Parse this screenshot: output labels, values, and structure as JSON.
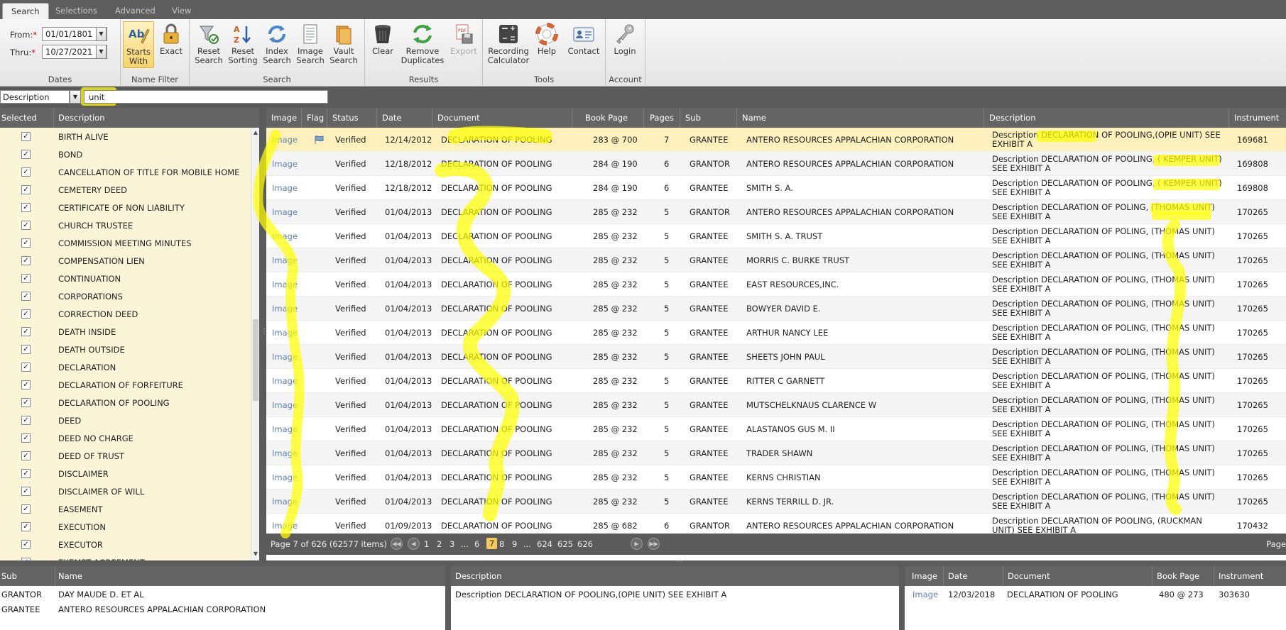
{
  "tabs": [
    {
      "label": "Search",
      "active": true
    },
    {
      "label": "Selections",
      "active": false
    },
    {
      "label": "Advanced",
      "active": false
    },
    {
      "label": "View",
      "active": false
    }
  ],
  "ribbon": {
    "dates": {
      "from_label": "From:",
      "from_value": "01/01/1801",
      "thru_label": "Thru:",
      "thru_value": "10/27/2021",
      "group_label": "Dates"
    },
    "name_filter": {
      "starts_with": "Starts With",
      "exact": "Exact",
      "group_label": "Name Filter"
    },
    "search": {
      "reset_search": "Reset Search",
      "reset_sorting": "Reset Sorting",
      "index_search": "Index Search",
      "image_search": "Image Search",
      "vault_search": "Vault Search",
      "group_label": "Search"
    },
    "results": {
      "clear": "Clear",
      "remove_duplicates": "Remove Duplicates",
      "export": "Export",
      "group_label": "Results"
    },
    "tools": {
      "recording_calculator": "Recording Calculator",
      "help": "Help",
      "contact": "Contact",
      "group_label": "Tools"
    },
    "account": {
      "login": "Login",
      "group_label": "Account"
    }
  },
  "filter": {
    "field": "Description",
    "value": "unit"
  },
  "left_panel": {
    "headers": {
      "selected": "Selected",
      "description": "Description"
    },
    "items": [
      "BIRTH ALIVE",
      "BOND",
      "CANCELLATION OF TITLE FOR MOBILE HOME",
      "CEMETERY DEED",
      "CERTIFICATE OF NON LIABILITY",
      "CHURCH TRUSTEE",
      "COMMISSION MEETING MINUTES",
      "COMPENSATION LIEN",
      "CONTINUATION",
      "CORPORATIONS",
      "CORRECTION DEED",
      "DEATH INSIDE",
      "DEATH OUTSIDE",
      "DECLARATION",
      "DECLARATION OF FORFEITURE",
      "DECLARATION OF POOLING",
      "DEED",
      "DEED NO CHARGE",
      "DEED OF TRUST",
      "DISCLAIMER",
      "DISCLAIMER OF WILL",
      "EASEMENT",
      "EXECUTION",
      "EXECUTOR",
      "EXEMPT AGREEMENT"
    ],
    "check_mark": "✓"
  },
  "grid": {
    "headers": {
      "image": "Image",
      "flag": "Flag",
      "status": "Status",
      "date": "Date",
      "document": "Document",
      "book_page": "Book Page",
      "pages": "Pages",
      "sub": "Sub",
      "name": "Name",
      "description": "Description",
      "instrument": "Instrument"
    },
    "rows": [
      {
        "image": "Image",
        "status": "Verified",
        "date": "12/14/2012",
        "document": "DECLARATION OF POOLING",
        "book_page": "283 @ 700",
        "pages": "7",
        "sub": "GRANTEE",
        "name": "ANTERO RESOURCES APPALACHIAN CORPORATION",
        "description": "Description DECLARATION OF POOLING,(OPIE UNIT) SEE EXHIBIT A",
        "instrument": "169681",
        "flag": true
      },
      {
        "image": "Image",
        "status": "Verified",
        "date": "12/18/2012",
        "document": "DECLARATION OF POOLING",
        "book_page": "284 @ 190",
        "pages": "6",
        "sub": "GRANTOR",
        "name": "ANTERO RESOURCES APPALACHIAN CORPORATION",
        "description": "Description DECLARATION OF POOLING, ( KEMPER UNIT) SEE EXHIBIT A",
        "instrument": "169808",
        "flag": false
      },
      {
        "image": "Image",
        "status": "Verified",
        "date": "12/18/2012",
        "document": "DECLARATION OF POOLING",
        "book_page": "284 @ 190",
        "pages": "6",
        "sub": "GRANTEE",
        "name": "SMITH S. A.",
        "description": "Description DECLARATION OF POOLING, ( KEMPER UNIT) SEE EXHIBIT A",
        "instrument": "169808",
        "flag": false
      },
      {
        "image": "Image",
        "status": "Verified",
        "date": "01/04/2013",
        "document": "DECLARATION OF POOLING",
        "book_page": "285 @ 232",
        "pages": "5",
        "sub": "GRANTOR",
        "name": "ANTERO RESOURCES APPALACHIAN CORPORATION",
        "description": "Description DECLARATION OF POLING, (THOMAS UNIT) SEE EXHIBIT A",
        "instrument": "170265",
        "flag": false
      },
      {
        "image": "Image",
        "status": "Verified",
        "date": "01/04/2013",
        "document": "DECLARATION OF POOLING",
        "book_page": "285 @ 232",
        "pages": "5",
        "sub": "GRANTEE",
        "name": "SMITH S. A. TRUST",
        "description": "Description DECLARATION OF POLING, (THOMAS UNIT) SEE EXHIBIT A",
        "instrument": "170265",
        "flag": false
      },
      {
        "image": "Image",
        "status": "Verified",
        "date": "01/04/2013",
        "document": "DECLARATION OF POOLING",
        "book_page": "285 @ 232",
        "pages": "5",
        "sub": "GRANTEE",
        "name": "MORRIS C. BURKE TRUST",
        "description": "Description DECLARATION OF POLING, (THOMAS UNIT) SEE EXHIBIT A",
        "instrument": "170265",
        "flag": false
      },
      {
        "image": "Image",
        "status": "Verified",
        "date": "01/04/2013",
        "document": "DECLARATION OF POOLING",
        "book_page": "285 @ 232",
        "pages": "5",
        "sub": "GRANTEE",
        "name": "EAST RESOURCES,INC.",
        "description": "Description DECLARATION OF POLING, (THOMAS UNIT) SEE EXHIBIT A",
        "instrument": "170265",
        "flag": false
      },
      {
        "image": "Image",
        "status": "Verified",
        "date": "01/04/2013",
        "document": "DECLARATION OF POOLING",
        "book_page": "285 @ 232",
        "pages": "5",
        "sub": "GRANTEE",
        "name": "BOWYER DAVID E.",
        "description": "Description DECLARATION OF POLING, (THOMAS UNIT) SEE EXHIBIT A",
        "instrument": "170265",
        "flag": false
      },
      {
        "image": "Image",
        "status": "Verified",
        "date": "01/04/2013",
        "document": "DECLARATION OF POOLING",
        "book_page": "285 @ 232",
        "pages": "5",
        "sub": "GRANTEE",
        "name": "ARTHUR NANCY LEE",
        "description": "Description DECLARATION OF POLING, (THOMAS UNIT) SEE EXHIBIT A",
        "instrument": "170265",
        "flag": false
      },
      {
        "image": "Image",
        "status": "Verified",
        "date": "01/04/2013",
        "document": "DECLARATION OF POOLING",
        "book_page": "285 @ 232",
        "pages": "5",
        "sub": "GRANTEE",
        "name": "SHEETS JOHN PAUL",
        "description": "Description DECLARATION OF POLING, (THOMAS UNIT) SEE EXHIBIT A",
        "instrument": "170265",
        "flag": false
      },
      {
        "image": "Image",
        "status": "Verified",
        "date": "01/04/2013",
        "document": "DECLARATION OF POOLING",
        "book_page": "285 @ 232",
        "pages": "5",
        "sub": "GRANTEE",
        "name": "RITTER C GARNETT",
        "description": "Description DECLARATION OF POLING, (THOMAS UNIT) SEE EXHIBIT A",
        "instrument": "170265",
        "flag": false
      },
      {
        "image": "Image",
        "status": "Verified",
        "date": "01/04/2013",
        "document": "DECLARATION OF POOLING",
        "book_page": "285 @ 232",
        "pages": "5",
        "sub": "GRANTEE",
        "name": "MUTSCHELKNAUS CLARENCE W",
        "description": "Description DECLARATION OF POLING, (THOMAS UNIT) SEE EXHIBIT A",
        "instrument": "170265",
        "flag": false
      },
      {
        "image": "Image",
        "status": "Verified",
        "date": "01/04/2013",
        "document": "DECLARATION OF POOLING",
        "book_page": "285 @ 232",
        "pages": "5",
        "sub": "GRANTEE",
        "name": "ALASTANOS GUS M. II",
        "description": "Description DECLARATION OF POLING, (THOMAS UNIT) SEE EXHIBIT A",
        "instrument": "170265",
        "flag": false
      },
      {
        "image": "Image",
        "status": "Verified",
        "date": "01/04/2013",
        "document": "DECLARATION OF POOLING",
        "book_page": "285 @ 232",
        "pages": "5",
        "sub": "GRANTEE",
        "name": "TRADER SHAWN",
        "description": "Description DECLARATION OF POLING, (THOMAS UNIT) SEE EXHIBIT A",
        "instrument": "170265",
        "flag": false
      },
      {
        "image": "Image",
        "status": "Verified",
        "date": "01/04/2013",
        "document": "DECLARATION OF POOLING",
        "book_page": "285 @ 232",
        "pages": "5",
        "sub": "GRANTEE",
        "name": "KERNS CHRISTIAN",
        "description": "Description DECLARATION OF POLING, (THOMAS UNIT) SEE EXHIBIT A",
        "instrument": "170265",
        "flag": false
      },
      {
        "image": "Image",
        "status": "Verified",
        "date": "01/04/2013",
        "document": "DECLARATION OF POOLING",
        "book_page": "285 @ 232",
        "pages": "5",
        "sub": "GRANTEE",
        "name": "KERNS TERRILL D. JR.",
        "description": "Description DECLARATION OF POLING, (THOMAS UNIT) SEE EXHIBIT A",
        "instrument": "170265",
        "flag": false
      },
      {
        "image": "Image",
        "status": "Verified",
        "date": "01/09/2013",
        "document": "DECLARATION OF POOLING",
        "book_page": "285 @ 682",
        "pages": "6",
        "sub": "GRANTOR",
        "name": "ANTERO RESOURCES APPALACHIAN CORPORATION",
        "description": "Description DECLARATION OF POOLING, (RUCKMAN UNIT) SEE EXHIBIT A",
        "instrument": "170432",
        "flag": false
      }
    ]
  },
  "pager": {
    "summary": "Page 7 of 626 (62577 items)",
    "pages": [
      "1",
      "2",
      "3",
      "...",
      "6",
      "7",
      "8",
      "9",
      "...",
      "624",
      "625",
      "626"
    ],
    "current": "7",
    "right_label": "Page"
  },
  "bottom": {
    "parties_headers": {
      "sub": "Sub",
      "name": "Name"
    },
    "parties": [
      {
        "sub": "GRANTOR",
        "name": "DAY MAUDE D. ET AL"
      },
      {
        "sub": "GRANTEE",
        "name": "ANTERO RESOURCES APPALACHIAN CORPORATION"
      }
    ],
    "description_header": "Description",
    "description": "Description DECLARATION OF POOLING,(OPIE UNIT) SEE EXHIBIT A",
    "related_headers": {
      "image": "Image",
      "date": "Date",
      "document": "Document",
      "book_page": "Book Page",
      "instrument": "Instrument"
    },
    "related": [
      {
        "image": "Image",
        "date": "12/03/2018",
        "document": "DECLARATION OF POOLING",
        "book_page": "480 @ 273",
        "instrument": "303630"
      }
    ]
  },
  "colors": {
    "highlighter": "#ffff00",
    "selected_row": "#fcf0bc",
    "link": "#5d7fb4",
    "header_bg": "#646464"
  }
}
